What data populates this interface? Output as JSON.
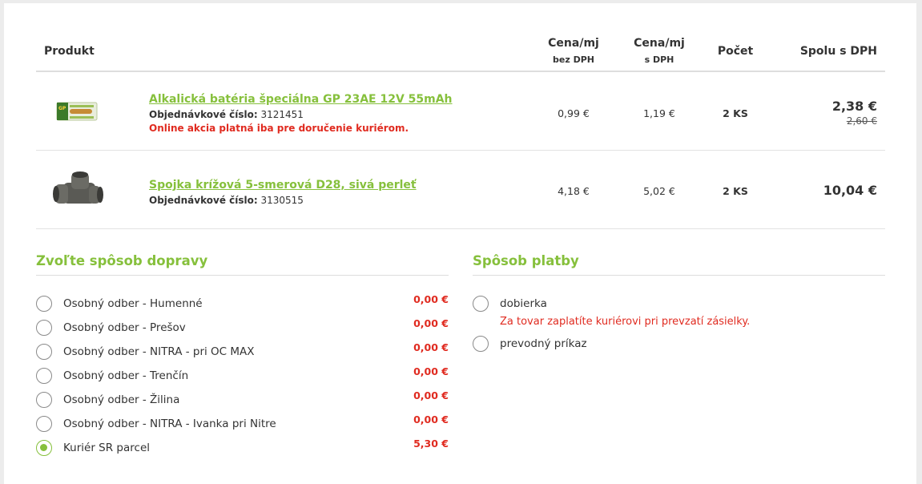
{
  "table": {
    "headers": {
      "product": "Produkt",
      "price_net": "Cena/mj",
      "price_net_sub": "bez DPH",
      "price_gross": "Cena/mj",
      "price_gross_sub": "s DPH",
      "quantity": "Počet",
      "total": "Spolu s DPH"
    },
    "items": [
      {
        "name": "Alkalická batéria špeciálna GP 23AE 12V 55mAh",
        "order_label": "Objednávkové číslo:",
        "order_no": "3121451",
        "promo": "Online akcia platná iba pre doručenie kuriérom.",
        "price_net": "0,99 €",
        "price_gross": "1,19 €",
        "qty": "2 KS",
        "total": "2,38 €",
        "total_old": "2,60 €",
        "image": "battery-image"
      },
      {
        "name": "Spojka krížová 5-smerová D28, sivá perleť",
        "order_label": "Objednávkové číslo:",
        "order_no": "3130515",
        "price_net": "4,18 €",
        "price_gross": "5,02 €",
        "qty": "2 KS",
        "total": "10,04 €",
        "image": "pipe-connector-image"
      }
    ]
  },
  "shipping": {
    "title": "Zvoľte spôsob dopravy",
    "options": [
      {
        "label": "Osobný odber - Humenné",
        "price": "0,00 €",
        "selected": false
      },
      {
        "label": "Osobný odber - Prešov",
        "price": "0,00 €",
        "selected": false
      },
      {
        "label": "Osobný odber - NITRA - pri OC MAX",
        "price": "0,00 €",
        "selected": false
      },
      {
        "label": "Osobný odber - Trenčín",
        "price": "0,00 €",
        "selected": false
      },
      {
        "label": "Osobný odber - Žilina",
        "price": "0,00 €",
        "selected": false
      },
      {
        "label": "Osobný odber - NITRA - Ivanka pri Nitre",
        "price": "0,00 €",
        "selected": false
      },
      {
        "label": "Kuriér SR parcel",
        "price": "5,30 €",
        "selected": true
      }
    ]
  },
  "payment": {
    "title": "Spôsob platby",
    "options": [
      {
        "label": "dobierka",
        "note": "Za tovar zaplatíte kuriérovi pri prevzatí zásielky."
      },
      {
        "label": "prevodný príkaz"
      }
    ]
  },
  "colors": {
    "accent": "#86c03c",
    "alert": "#e02b20",
    "background": "#ececec"
  }
}
